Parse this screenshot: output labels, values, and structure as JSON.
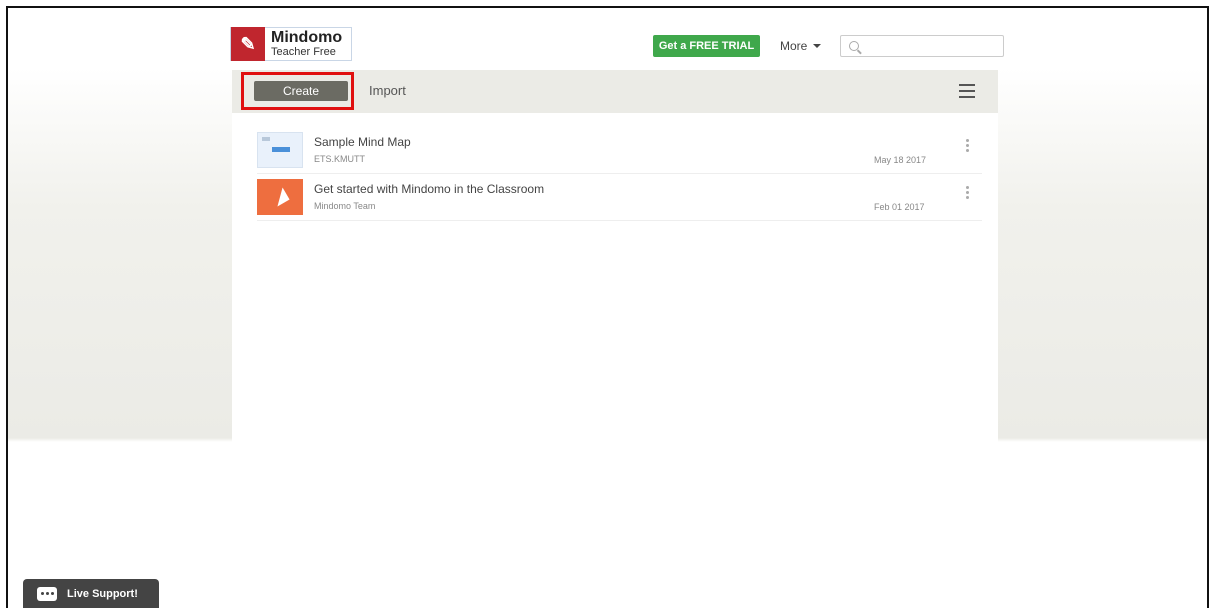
{
  "header": {
    "logo_title": "Mindomo",
    "logo_subtitle": "Teacher Free",
    "trial_button": "Get a FREE TRIAL",
    "more_label": "More",
    "search_placeholder": ""
  },
  "toolbar": {
    "create_label": "Create",
    "import_label": "Import"
  },
  "maps": [
    {
      "title": "Sample Mind Map",
      "author": "ETS.KMUTT",
      "date": "May 18 2017",
      "thumb": "mind-map-thumbnail"
    },
    {
      "title": "Get started with Mindomo in the Classroom",
      "author": "Mindomo Team",
      "date": "Feb 01 2017",
      "thumb": "paper-plane-thumbnail"
    }
  ],
  "support": {
    "label": "Live Support!"
  },
  "colors": {
    "trial_green": "#3fa84b",
    "highlight_red": "#e01010",
    "create_bg": "#6b6b63",
    "logo_red": "#c0262e"
  }
}
